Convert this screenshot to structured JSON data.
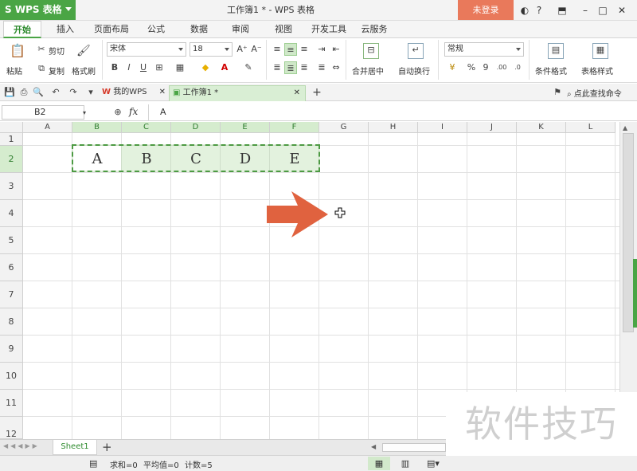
{
  "app": {
    "name": "WPS 表格",
    "doc_title": "工作簿1 * - WPS 表格",
    "login_label": "未登录"
  },
  "menu": {
    "tabs": [
      "开始",
      "插入",
      "页面布局",
      "公式",
      "数据",
      "审阅",
      "视图",
      "开发工具",
      "云服务"
    ],
    "active": "开始"
  },
  "ribbon": {
    "paste": "粘贴",
    "cut": "剪切",
    "copy": "复制",
    "format_painter": "格式刷",
    "font_name": "宋体",
    "font_size": "18",
    "number_format": "常规",
    "merge_center": "合并居中",
    "wrap_text": "自动换行",
    "conditional_format": "条件格式",
    "table_style": "表格样式",
    "bold": "B",
    "italic": "I",
    "underline": "U",
    "percent": "%",
    "comma": "9"
  },
  "doc_tabs": {
    "home": "我的WPS",
    "workbook": "工作簿1 *",
    "search": "点此查找命令"
  },
  "formula_bar": {
    "name_box": "B2",
    "fx": "fx",
    "value": "A"
  },
  "sheet": {
    "columns": [
      "A",
      "B",
      "C",
      "D",
      "E",
      "F",
      "G",
      "H",
      "I",
      "J",
      "K",
      "L"
    ],
    "rows": [
      "1",
      "2",
      "3",
      "4",
      "5",
      "6",
      "7",
      "8",
      "9",
      "10",
      "11",
      "12"
    ],
    "row2_values": [
      "A",
      "B",
      "C",
      "D",
      "E"
    ],
    "tabs": [
      "Sheet1"
    ]
  },
  "status": {
    "sum": "求和=0",
    "avg": "平均值=0",
    "count": "计数=5"
  },
  "watermark": "软件技巧",
  "colors": {
    "accent": "#4aa545",
    "login": "#e9795b",
    "arrow": "#e0623f"
  },
  "icons": {
    "arrow": "right-arrow-icon",
    "cursor": "move-cursor-icon"
  }
}
